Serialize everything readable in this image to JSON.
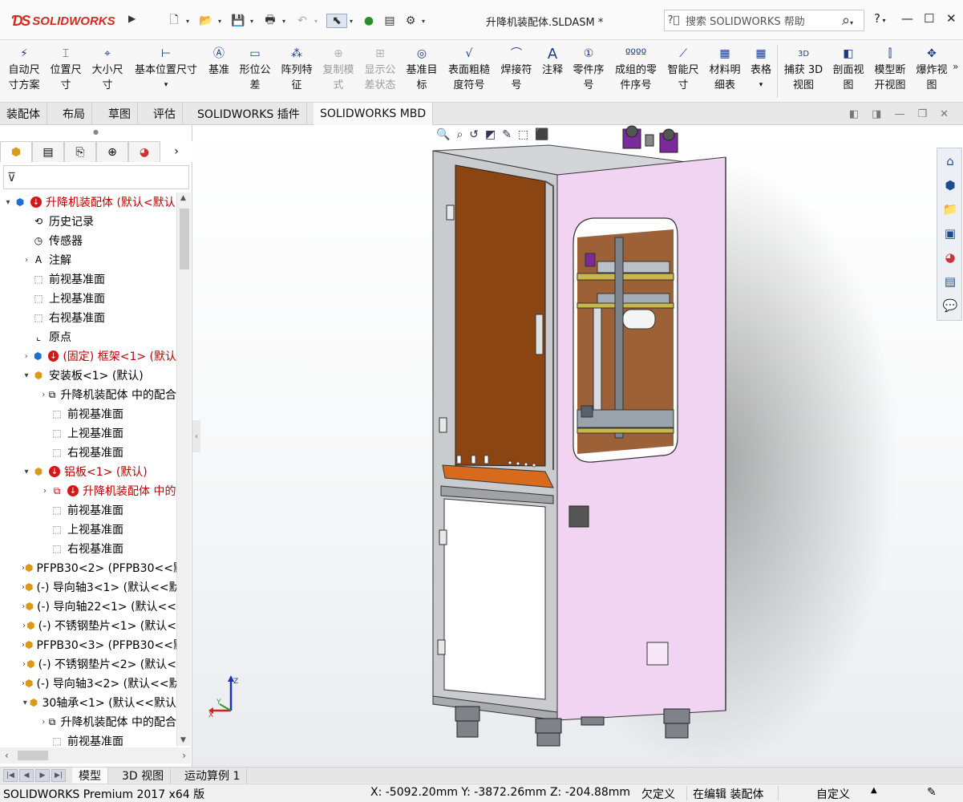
{
  "window": {
    "app_name": "SOLIDWORKS",
    "document_title": "升降机装配体.SLDASM *",
    "search_placeholder": "搜索 SOLIDWORKS 帮助",
    "help_label": "?"
  },
  "ribbon": {
    "commands": [
      {
        "label1": "自动尺",
        "label2": "寸方案",
        "icon": "auto-dimension-scheme-icon",
        "enabled": true
      },
      {
        "label1": "位置尺",
        "label2": "寸",
        "icon": "location-dimension-icon",
        "enabled": true
      },
      {
        "label1": "大小尺",
        "label2": "寸",
        "icon": "size-dimension-icon",
        "enabled": true
      },
      {
        "label1": "基本位置尺寸",
        "label2": "",
        "icon": "basic-location-dimension-icon",
        "enabled": true
      },
      {
        "label1": "基准",
        "label2": "",
        "icon": "datum-icon",
        "enabled": true
      },
      {
        "label1": "形位公",
        "label2": "差",
        "icon": "geometric-tolerance-icon",
        "enabled": true
      },
      {
        "label1": "阵列特",
        "label2": "征",
        "icon": "pattern-feature-icon",
        "enabled": true
      },
      {
        "label1": "复制模",
        "label2": "式",
        "icon": "copy-scheme-icon",
        "enabled": false
      },
      {
        "label1": "显示公",
        "label2": "差状态",
        "icon": "show-tolerance-status-icon",
        "enabled": false
      },
      {
        "label1": "基准目",
        "label2": "标",
        "icon": "datum-target-icon",
        "enabled": true
      },
      {
        "label1": "表面粗糙",
        "label2": "度符号",
        "icon": "surface-finish-icon",
        "enabled": true
      },
      {
        "label1": "焊接符",
        "label2": "号",
        "icon": "weld-symbol-icon",
        "enabled": true
      },
      {
        "label1": "注释",
        "label2": "",
        "icon": "note-icon",
        "enabled": true
      },
      {
        "label1": "零件序",
        "label2": "号",
        "icon": "balloon-icon",
        "enabled": true
      },
      {
        "label1": "成组的零",
        "label2": "件序号",
        "icon": "stacked-balloon-icon",
        "enabled": true
      },
      {
        "label1": "智能尺",
        "label2": "寸",
        "icon": "smart-dimension-icon",
        "enabled": true
      },
      {
        "label1": "材料明",
        "label2": "细表",
        "icon": "bom-icon",
        "enabled": true
      },
      {
        "label1": "表格",
        "label2": "",
        "icon": "table-icon",
        "enabled": true
      },
      {
        "label1": "捕获 3D",
        "label2": "视图",
        "icon": "capture-3d-view-icon",
        "enabled": true
      },
      {
        "label1": "剖面视",
        "label2": "图",
        "icon": "section-view-icon",
        "enabled": true
      },
      {
        "label1": "模型断",
        "label2": "开视图",
        "icon": "model-break-view-icon",
        "enabled": true
      },
      {
        "label1": "爆炸视",
        "label2": "图",
        "icon": "exploded-view-icon",
        "enabled": true
      }
    ]
  },
  "command_tabs": [
    "装配体",
    "布局",
    "草图",
    "评估",
    "SOLIDWORKS 插件",
    "SOLIDWORKS MBD"
  ],
  "active_command_tab": "SOLIDWORKS MBD",
  "feature_tree": [
    {
      "level": 0,
      "expand": "▾",
      "icon": "assembly-icon",
      "error": true,
      "text": "升降机装配体  (默认<默认",
      "red": true
    },
    {
      "level": 1,
      "expand": "",
      "icon": "history-icon",
      "error": false,
      "text": "历史记录",
      "red": false
    },
    {
      "level": 1,
      "expand": "",
      "icon": "sensor-icon",
      "error": false,
      "text": "传感器",
      "red": false
    },
    {
      "level": 1,
      "expand": "›",
      "icon": "annotation-icon",
      "error": false,
      "text": "注解",
      "red": false
    },
    {
      "level": 1,
      "expand": "",
      "icon": "plane-icon",
      "error": false,
      "text": "前视基准面",
      "red": false
    },
    {
      "level": 1,
      "expand": "",
      "icon": "plane-icon",
      "error": false,
      "text": "上视基准面",
      "red": false
    },
    {
      "level": 1,
      "expand": "",
      "icon": "plane-icon",
      "error": false,
      "text": "右视基准面",
      "red": false
    },
    {
      "level": 1,
      "expand": "",
      "icon": "origin-icon",
      "error": false,
      "text": "原点",
      "red": false
    },
    {
      "level": 1,
      "expand": "›",
      "icon": "subassembly-icon",
      "error": true,
      "text": "(固定) 框架<1> (默认",
      "red": true
    },
    {
      "level": 1,
      "expand": "▾",
      "icon": "part-icon",
      "error": false,
      "text": "安装板<1> (默认)",
      "red": false
    },
    {
      "level": 2,
      "expand": "›",
      "icon": "mates-icon",
      "error": false,
      "text": "升降机装配体 中的配合",
      "red": false
    },
    {
      "level": 2,
      "expand": "",
      "icon": "plane-icon",
      "error": false,
      "text": "前视基准面",
      "red": false
    },
    {
      "level": 2,
      "expand": "",
      "icon": "plane-icon",
      "error": false,
      "text": "上视基准面",
      "red": false
    },
    {
      "level": 2,
      "expand": "",
      "icon": "plane-icon",
      "error": false,
      "text": "右视基准面",
      "red": false
    },
    {
      "level": 1,
      "expand": "▾",
      "icon": "part-icon",
      "error": true,
      "text": "铝板<1> (默认)",
      "red": true
    },
    {
      "level": 2,
      "expand": "›",
      "icon": "mates-icon",
      "error": true,
      "text": "升降机装配体 中的",
      "red": true
    },
    {
      "level": 2,
      "expand": "",
      "icon": "plane-icon",
      "error": false,
      "text": "前视基准面",
      "red": false
    },
    {
      "level": 2,
      "expand": "",
      "icon": "plane-icon",
      "error": false,
      "text": "上视基准面",
      "red": false
    },
    {
      "level": 2,
      "expand": "",
      "icon": "plane-icon",
      "error": false,
      "text": "右视基准面",
      "red": false
    },
    {
      "level": 1,
      "expand": "›",
      "icon": "part-icon",
      "error": false,
      "text": "PFPB30<2> (PFPB30<<默",
      "red": false
    },
    {
      "level": 1,
      "expand": "›",
      "icon": "part-icon",
      "error": false,
      "text": "(-) 导向轴3<1> (默认<<默",
      "red": false
    },
    {
      "level": 1,
      "expand": "›",
      "icon": "part-icon",
      "error": false,
      "text": "(-) 导向轴22<1> (默认<<",
      "red": false
    },
    {
      "level": 1,
      "expand": "›",
      "icon": "part-icon",
      "error": false,
      "text": "(-) 不锈钢垫片<1> (默认<",
      "red": false
    },
    {
      "level": 1,
      "expand": "›",
      "icon": "part-icon",
      "error": false,
      "text": "PFPB30<3> (PFPB30<<默",
      "red": false
    },
    {
      "level": 1,
      "expand": "›",
      "icon": "part-icon",
      "error": false,
      "text": "(-) 不锈钢垫片<2> (默认<",
      "red": false
    },
    {
      "level": 1,
      "expand": "›",
      "icon": "part-icon",
      "error": false,
      "text": "(-) 导向轴3<2> (默认<<默",
      "red": false
    },
    {
      "level": 1,
      "expand": "▾",
      "icon": "part-icon",
      "error": false,
      "text": "30轴承<1> (默认<<默认",
      "red": false
    },
    {
      "level": 2,
      "expand": "›",
      "icon": "mates-icon",
      "error": false,
      "text": "升降机装配体 中的配合",
      "red": false
    },
    {
      "level": 2,
      "expand": "",
      "icon": "plane-icon",
      "error": false,
      "text": "前视基准面",
      "red": false
    }
  ],
  "bottom_tabs": [
    "模型",
    "3D 视图",
    "运动算例 1"
  ],
  "active_bottom_tab": "模型",
  "status_bar": {
    "product": "SOLIDWORKS Premium 2017 x64 版",
    "coordinates": "X: -5092.20mm Y: -3872.26mm Z: -204.88mm",
    "definition": "欠定义",
    "editing": "在编辑 装配体",
    "units": "自定义"
  },
  "colors": {
    "logo_red": "#d52b1e",
    "panel_pink": "#f0d4f2",
    "panel_brown": "#8b4513",
    "error_red": "#d41818",
    "frame_gray": "#c7c9cc"
  }
}
